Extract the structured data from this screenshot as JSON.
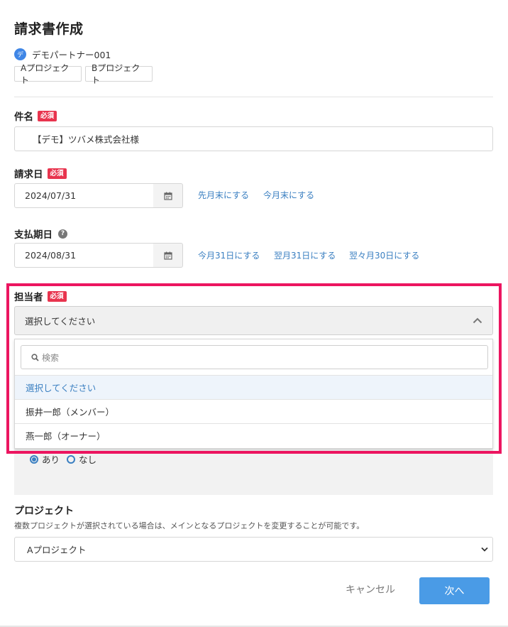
{
  "page": {
    "title": "請求書作成"
  },
  "partner": {
    "icon_glyph": "デ",
    "icon": "partner-avatar-icon",
    "name": "デモパートナー001"
  },
  "project_tags": [
    "Aプロジェクト",
    "Bプロジェクト"
  ],
  "required_label": "必須",
  "subject": {
    "label": "件名",
    "value": "【デモ】ツバメ株式会社様"
  },
  "invoice_date": {
    "label": "請求日",
    "value": "2024/07/31",
    "links": [
      "先月末にする",
      "今月末にする"
    ]
  },
  "due_date": {
    "label": "支払期日",
    "help_icon": "?",
    "value": "2024/08/31",
    "links": [
      "今月31日にする",
      "翌月31日にする",
      "翌々月30日にする"
    ]
  },
  "assignee": {
    "label": "担当者",
    "value": "選択してください",
    "search_placeholder": "検索",
    "options": [
      "選択してください",
      "振井一郎（メンバー）",
      "燕一郎（オーナー）"
    ]
  },
  "partial_radios": {
    "yes": "あり",
    "no": "なし",
    "selected": "yes"
  },
  "project": {
    "label": "プロジェクト",
    "hint": "複数プロジェクトが選択されている場合は、メインとなるプロジェクトを変更することが可能です。",
    "value": "Aプロジェクト"
  },
  "actions": {
    "cancel": "キャンセル",
    "next": "次へ"
  },
  "colors": {
    "accent": "#3a7fc1",
    "required": "#e8344e",
    "highlight": "#ec1560",
    "primary_button": "#4a9be6"
  }
}
